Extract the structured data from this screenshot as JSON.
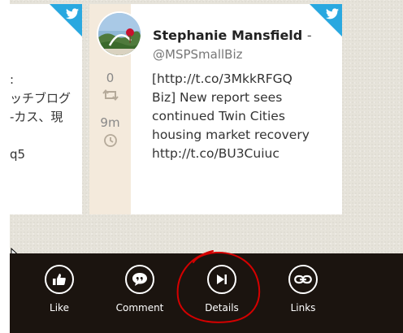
{
  "tweets": [
    {
      "partial_text": ":\nッチブログ\n-カス、現\n\nq5"
    },
    {
      "author": "Stephanie Mansfield",
      "separator": "-",
      "handle": "@MSPSmallBiz",
      "retweets": "0",
      "time": "9m",
      "text": "[http://t.co/3MkkRFGQ\nBiz] New report sees\ncontinued Twin Cities\nhousing market recovery\nhttp://t.co/BU3Cuiuc"
    }
  ],
  "appbar": {
    "buttons": [
      {
        "label": "Like",
        "icon": "thumbs-up-icon"
      },
      {
        "label": "Comment",
        "icon": "comment-icon"
      },
      {
        "label": "Details",
        "icon": "play-next-icon"
      },
      {
        "label": "Links",
        "icon": "link-icon"
      }
    ]
  },
  "colors": {
    "twitter_blue": "#29a8e0",
    "appbar_bg": "#1b140f",
    "meta_col_bg": "#f4eadc",
    "annotation_red": "#d40000"
  }
}
